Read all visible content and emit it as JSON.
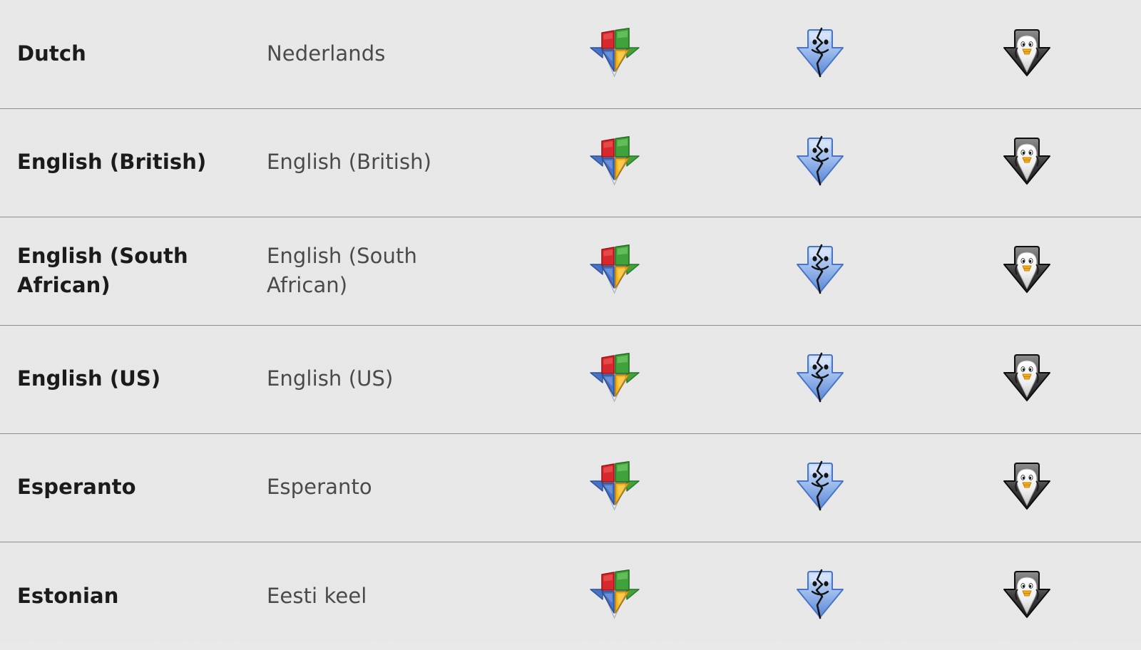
{
  "page": {
    "background_color": "#e9e9e9",
    "divider_color": "#8d8d8d",
    "text_color_primary": "#1b1b1b",
    "text_color_secondary": "#4a4a4a"
  },
  "columns": [
    {
      "key": "english_name",
      "label": ""
    },
    {
      "key": "native_name",
      "label": ""
    },
    {
      "key": "windows_download",
      "label": ""
    },
    {
      "key": "mac_download",
      "label": ""
    },
    {
      "key": "linux_download",
      "label": ""
    }
  ],
  "icons": {
    "windows": {
      "name": "windows-download-icon",
      "colors": [
        "#d7282f",
        "#3fa23a",
        "#4a72c4",
        "#f2b51c"
      ]
    },
    "mac": {
      "name": "mac-finder-download-icon",
      "colors": [
        "#9cc0ef",
        "#5b86d6",
        "#1f1f1f"
      ]
    },
    "linux": {
      "name": "linux-tux-download-icon",
      "colors": [
        "#f4f4f4",
        "#7a7a7a",
        "#101010",
        "#f2ae18"
      ]
    }
  },
  "rows": [
    {
      "english_name": "Dutch",
      "native_name": "Nederlands",
      "windows_download": "windows-download-icon",
      "mac_download": "mac-finder-download-icon",
      "linux_download": "linux-tux-download-icon"
    },
    {
      "english_name": "English (British)",
      "native_name": "English (British)",
      "windows_download": "windows-download-icon",
      "mac_download": "mac-finder-download-icon",
      "linux_download": "linux-tux-download-icon"
    },
    {
      "english_name": "English (South African)",
      "native_name": "English (South African)",
      "windows_download": "windows-download-icon",
      "mac_download": "mac-finder-download-icon",
      "linux_download": "linux-tux-download-icon"
    },
    {
      "english_name": "English (US)",
      "native_name": "English (US)",
      "windows_download": "windows-download-icon",
      "mac_download": "mac-finder-download-icon",
      "linux_download": "linux-tux-download-icon"
    },
    {
      "english_name": "Esperanto",
      "native_name": "Esperanto",
      "windows_download": "windows-download-icon",
      "mac_download": "mac-finder-download-icon",
      "linux_download": "linux-tux-download-icon"
    },
    {
      "english_name": "Estonian",
      "native_name": "Eesti keel",
      "windows_download": "windows-download-icon",
      "mac_download": "mac-finder-download-icon",
      "linux_download": "linux-tux-download-icon"
    }
  ]
}
